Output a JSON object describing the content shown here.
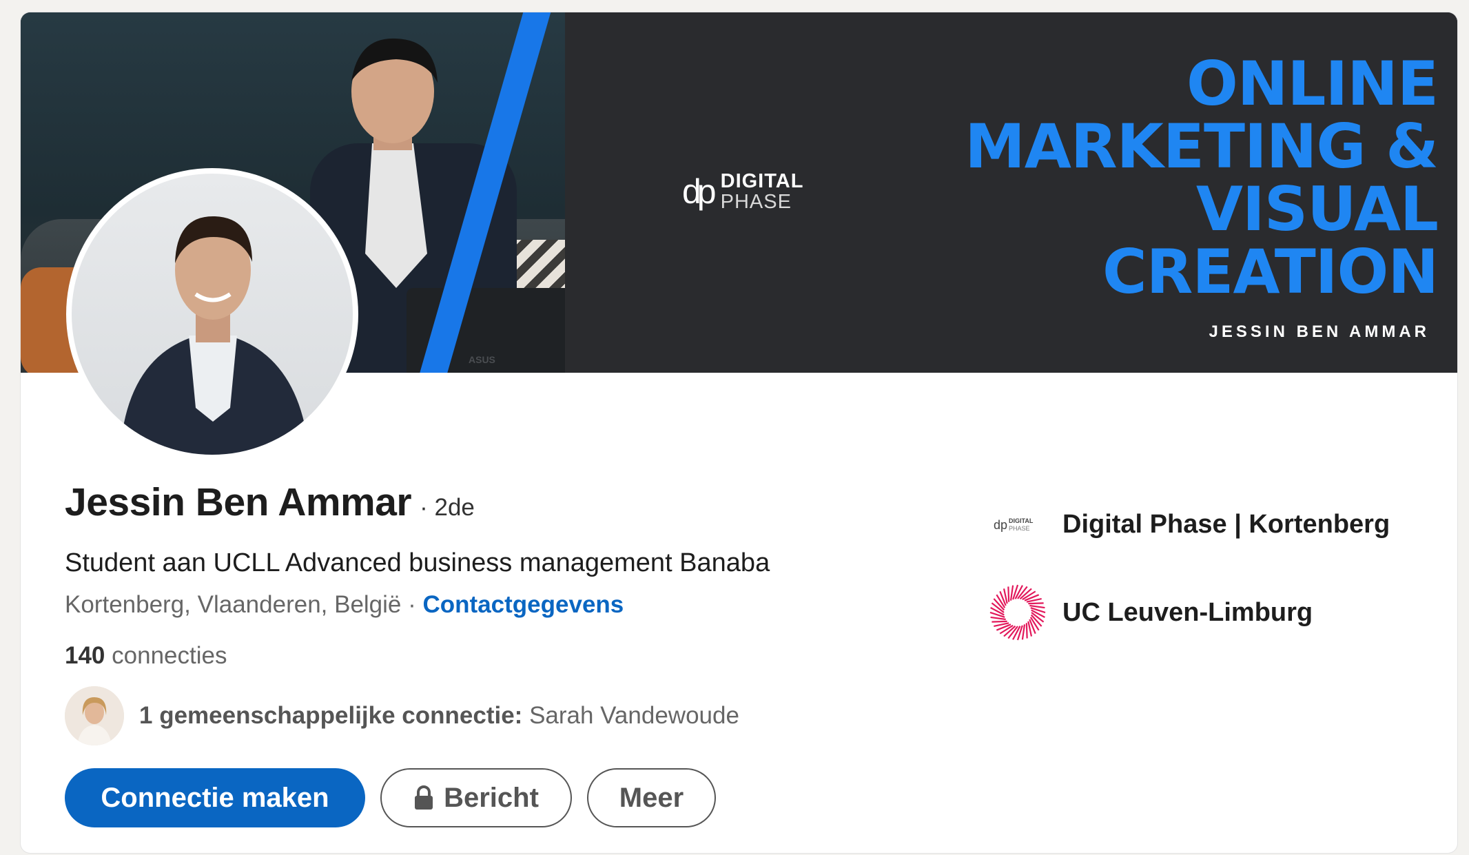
{
  "banner": {
    "logo_top": "DIGITAL",
    "logo_bottom": "PHASE",
    "headline_lines": [
      "ONLINE",
      "MARKETING &",
      "VISUAL",
      "CREATION"
    ],
    "name": "JESSIN BEN AMMAR",
    "laptop_brand": "ASUS"
  },
  "profile": {
    "name": "Jessin Ben Ammar",
    "degree": "· 2de",
    "headline": "Student aan UCLL Advanced business management Banaba",
    "location": "Kortenberg, Vlaanderen, België ·",
    "contact_link": "Contactgegevens",
    "connections_count": "140",
    "connections_label": "connecties",
    "mutual_label": "1 gemeenschappelijke connectie:",
    "mutual_name": "Sarah Vandewoude"
  },
  "actions": {
    "connect": "Connectie maken",
    "message": "Bericht",
    "more": "Meer"
  },
  "organizations": [
    {
      "name": "Digital Phase | Kortenberg",
      "logo_text_top": "DIGITAL",
      "logo_text_bottom": "PHASE"
    },
    {
      "name": "UC Leuven-Limburg"
    }
  ],
  "colors": {
    "primary": "#0a66c2",
    "banner_accent": "#1f86f2",
    "ucll": "#e2185b"
  }
}
